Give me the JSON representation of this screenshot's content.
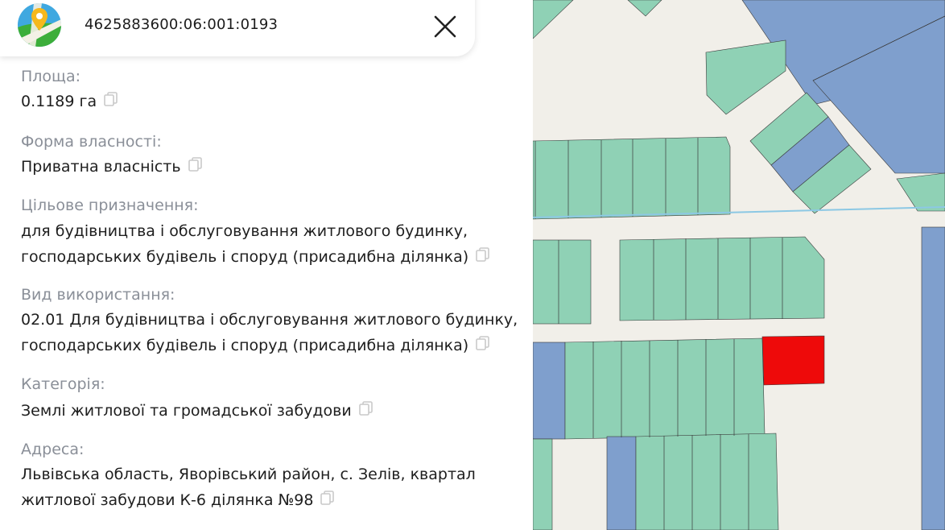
{
  "header": {
    "cadastral_number": "4625883600:06:001:0193",
    "logo_icon": "map-pin-logo-icon",
    "close_icon": "close-icon"
  },
  "fields": [
    {
      "label": "Площа:",
      "value_lines": [
        "0.1189 га"
      ]
    },
    {
      "label": "Форма власності:",
      "value_lines": [
        "Приватна власність"
      ]
    },
    {
      "label": "Цільове призначення:",
      "value_lines": [
        "для будівництва і обслуговування житлового будинку,",
        "господарських будівель і споруд (присадибна ділянка)"
      ]
    },
    {
      "label": "Вид використання:",
      "value_lines": [
        "02.01 Для будівництва і обслуговування житлового будинку,",
        "господарських будівель і споруд (присадибна ділянка)"
      ]
    },
    {
      "label": "Категорія:",
      "value_lines": [
        "Землі житлової та громадської забудови"
      ]
    },
    {
      "label": "Адреса:",
      "value_lines": [
        "Львівська область, Яворівський район, с. Зелів, квартал",
        "житлової забудови К-6 ділянка №98"
      ]
    }
  ],
  "colors": {
    "parcel_green": "#8fd1b5",
    "parcel_blue": "#7f9fcd",
    "selected_parcel": "#ee0a0a",
    "map_background": "#f1efe9"
  }
}
